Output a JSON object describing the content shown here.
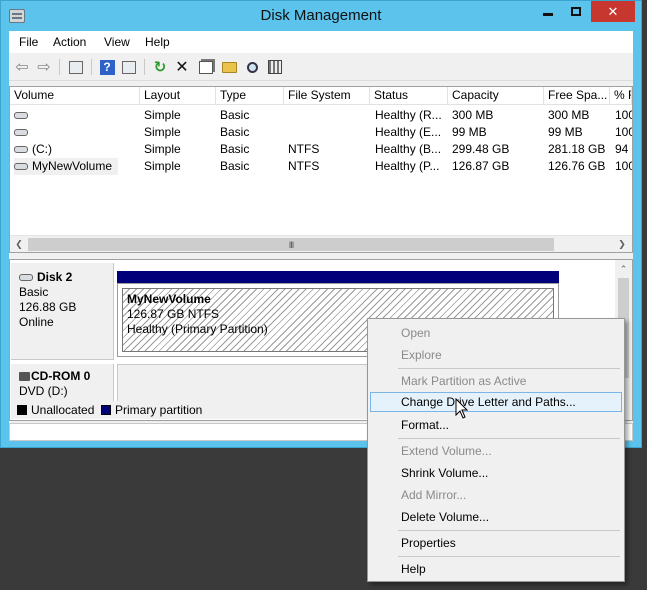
{
  "window": {
    "title": "Disk Management"
  },
  "menubar": {
    "items": [
      "File",
      "Action",
      "View",
      "Help"
    ]
  },
  "toolbar": {
    "icons": [
      "back-arrow",
      "forward-arrow",
      "show-hide-console-tree",
      "help",
      "show-action-pane",
      "refresh",
      "delete",
      "properties",
      "open-folder",
      "find",
      "settings"
    ]
  },
  "volume_list": {
    "columns": [
      "Volume",
      "Layout",
      "Type",
      "File System",
      "Status",
      "Capacity",
      "Free Spa...",
      "% F"
    ],
    "rows": [
      {
        "volume": "",
        "layout": "Simple",
        "type": "Basic",
        "fs": "",
        "status": "Healthy (R...",
        "capacity": "300 MB",
        "free": "300 MB",
        "pct": "100"
      },
      {
        "volume": "",
        "layout": "Simple",
        "type": "Basic",
        "fs": "",
        "status": "Healthy (E...",
        "capacity": "99 MB",
        "free": "99 MB",
        "pct": "100"
      },
      {
        "volume": "(C:)",
        "layout": "Simple",
        "type": "Basic",
        "fs": "NTFS",
        "status": "Healthy (B...",
        "capacity": "299.48 GB",
        "free": "281.18 GB",
        "pct": "94"
      },
      {
        "volume": "MyNewVolume",
        "layout": "Simple",
        "type": "Basic",
        "fs": "NTFS",
        "status": "Healthy (P...",
        "capacity": "126.87 GB",
        "free": "126.76 GB",
        "pct": "100"
      }
    ],
    "scroll_thumb": "III"
  },
  "disk2": {
    "name": "Disk 2",
    "type": "Basic",
    "size": "126.88 GB",
    "state": "Online",
    "partition": {
      "name": "MyNewVolume",
      "detail": "126.87 GB NTFS",
      "status": "Healthy (Primary Partition)"
    }
  },
  "cdrom": {
    "name": "CD-ROM 0",
    "detail": "DVD (D:)"
  },
  "legend": {
    "unallocated": "Unallocated",
    "primary": "Primary partition",
    "colors": {
      "unallocated": "#000000",
      "primary": "#00007a"
    }
  },
  "context_menu": {
    "items": {
      "open": "Open",
      "explore": "Explore",
      "mark_active": "Mark Partition as Active",
      "change_letter": "Change Drive Letter and Paths...",
      "format": "Format...",
      "extend": "Extend Volume...",
      "shrink": "Shrink Volume...",
      "add_mirror": "Add Mirror...",
      "delete": "Delete Volume...",
      "properties": "Properties",
      "help": "Help"
    }
  },
  "colors": {
    "title_bar": "#5bc3ec",
    "close_button": "#c7372f",
    "menu_hover": "#e5f1fb"
  }
}
